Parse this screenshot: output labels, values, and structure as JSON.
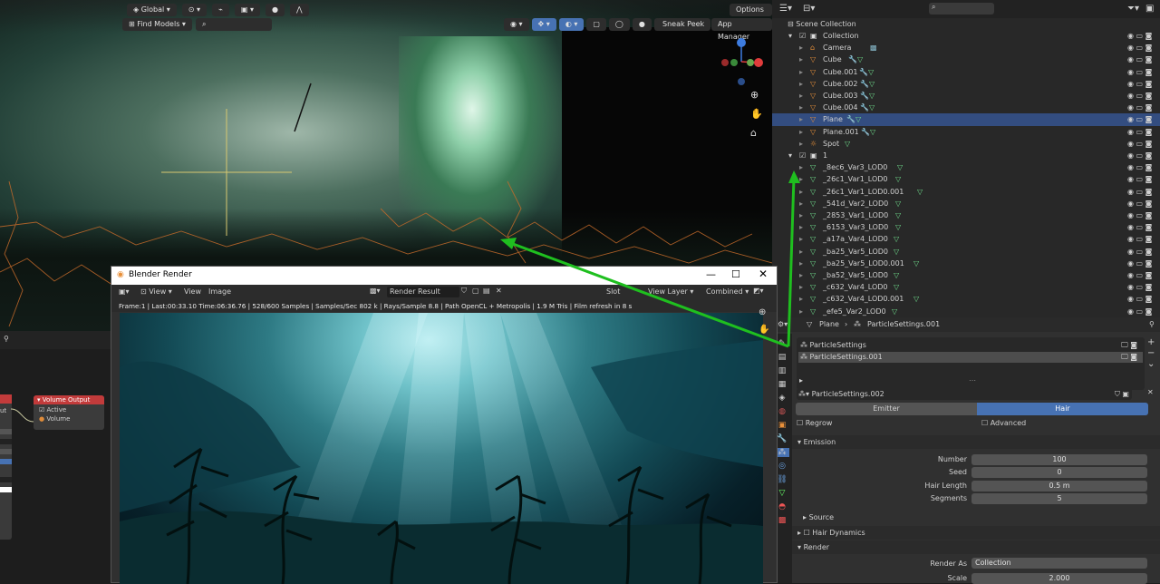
{
  "viewport": {
    "transform": "Global",
    "find_models": "Find Models",
    "options": "Options",
    "sneak_peek": "Sneak Peek",
    "app_manager": "App Manager"
  },
  "outliner": {
    "root": "Scene Collection",
    "rows": [
      {
        "label": "Collection"
      },
      {
        "label": "Camera"
      },
      {
        "label": "Cube"
      },
      {
        "label": "Cube.001"
      },
      {
        "label": "Cube.002"
      },
      {
        "label": "Cube.003"
      },
      {
        "label": "Cube.004"
      },
      {
        "label": "Plane"
      },
      {
        "label": "Plane.001"
      },
      {
        "label": "Spot"
      },
      {
        "label": "1"
      },
      {
        "label": "_8ec6_Var3_LOD0"
      },
      {
        "label": "_26c1_Var1_LOD0"
      },
      {
        "label": "_26c1_Var1_LOD0.001"
      },
      {
        "label": "_541d_Var2_LOD0"
      },
      {
        "label": "_2853_Var1_LOD0"
      },
      {
        "label": "_6153_Var3_LOD0"
      },
      {
        "label": "_a17a_Var4_LOD0"
      },
      {
        "label": "_ba25_Var5_LOD0"
      },
      {
        "label": "_ba25_Var5_LOD0.001"
      },
      {
        "label": "_ba52_Var5_LOD0"
      },
      {
        "label": "_c632_Var4_LOD0"
      },
      {
        "label": "_c632_Var4_LOD0.001"
      },
      {
        "label": "_efe5_Var2_LOD0"
      }
    ]
  },
  "properties": {
    "breadcrumb_object": "Plane",
    "breadcrumb_settings": "ParticleSettings.001",
    "slots": [
      "ParticleSettings",
      "ParticleSettings.001"
    ],
    "datablock": "ParticleSettings.002",
    "type_emitter": "Emitter",
    "type_hair": "Hair",
    "regrow": "Regrow",
    "advanced": "Advanced",
    "emission_header": "Emission",
    "number_label": "Number",
    "number_value": "100",
    "seed_label": "Seed",
    "seed_value": "0",
    "hair_length_label": "Hair Length",
    "hair_length_value": "0.5 m",
    "segments_label": "Segments",
    "segments_value": "5",
    "source_header": "Source",
    "hair_dynamics_header": "Hair Dynamics",
    "render_header": "Render",
    "render_as_label": "Render As",
    "render_as_value": "Collection",
    "scale_label": "Scale",
    "scale_value": "2.000"
  },
  "node_editor": {
    "node_title": "Volume Output",
    "active_label": "Active",
    "volume_label": "Volume",
    "left_socket_label": "ut"
  },
  "render_window": {
    "title": "Blender Render",
    "view_menu": "View",
    "view_menu2": "View",
    "image_menu": "Image",
    "image_name": "Render Result",
    "slot": "Slot",
    "view_layer": "View Layer",
    "pass": "Combined",
    "info": "Frame:1 | Last:00:33.10 Time:06:36.76 | 528/600 Samples | Samples/Sec 802 k | Rays/Sample 8.8 | Path OpenCL + Metropolis | 1.9 M Tris | Film refresh in 8 s"
  },
  "colors": {
    "selection": "#334d80",
    "annotation_arrow": "#1fbf1f",
    "node_header": "#c23b3b",
    "hair_button": "#4772b3"
  }
}
